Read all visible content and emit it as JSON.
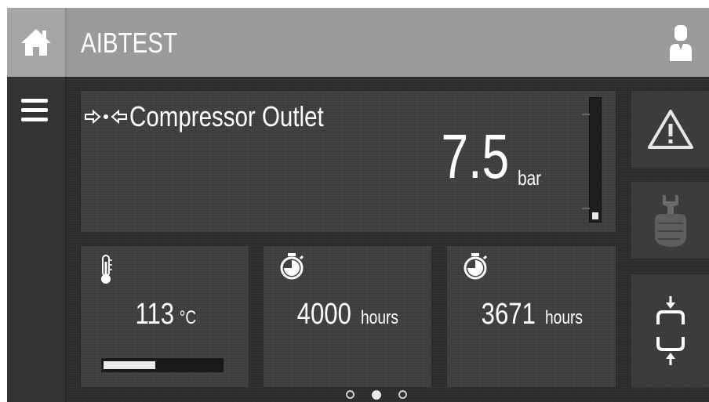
{
  "header": {
    "title": "AIBTEST",
    "home_icon": "home-icon",
    "user_icon": "user-icon"
  },
  "sidebar": {
    "menu_icon": "hamburger-menu-icon"
  },
  "outlet": {
    "label": "Compressor Outlet",
    "value": "7.5",
    "unit": "bar",
    "icon": "compressor-outlet-arrows-icon",
    "bar_level": 0.06
  },
  "temperature": {
    "value": "113",
    "unit": "°C",
    "icon": "thermometer-icon",
    "bar_level": 0.44
  },
  "hours_1": {
    "value": "4000",
    "unit": "hours",
    "icon": "stopwatch-icon"
  },
  "hours_2": {
    "value": "3671",
    "unit": "hours",
    "icon": "stopwatch-icon"
  },
  "side_buttons": {
    "alarm_icon": "warning-triangle-icon",
    "service_icon": "service-wrench-hand-icon",
    "cycle_icon": "load-unload-cycle-icon"
  },
  "pager": {
    "pages": 3,
    "active": 2
  },
  "colors": {
    "background": "#2b2b2b",
    "header": "#9a9a9a",
    "tile": "#3c3c3c",
    "text": "#ffffff"
  }
}
